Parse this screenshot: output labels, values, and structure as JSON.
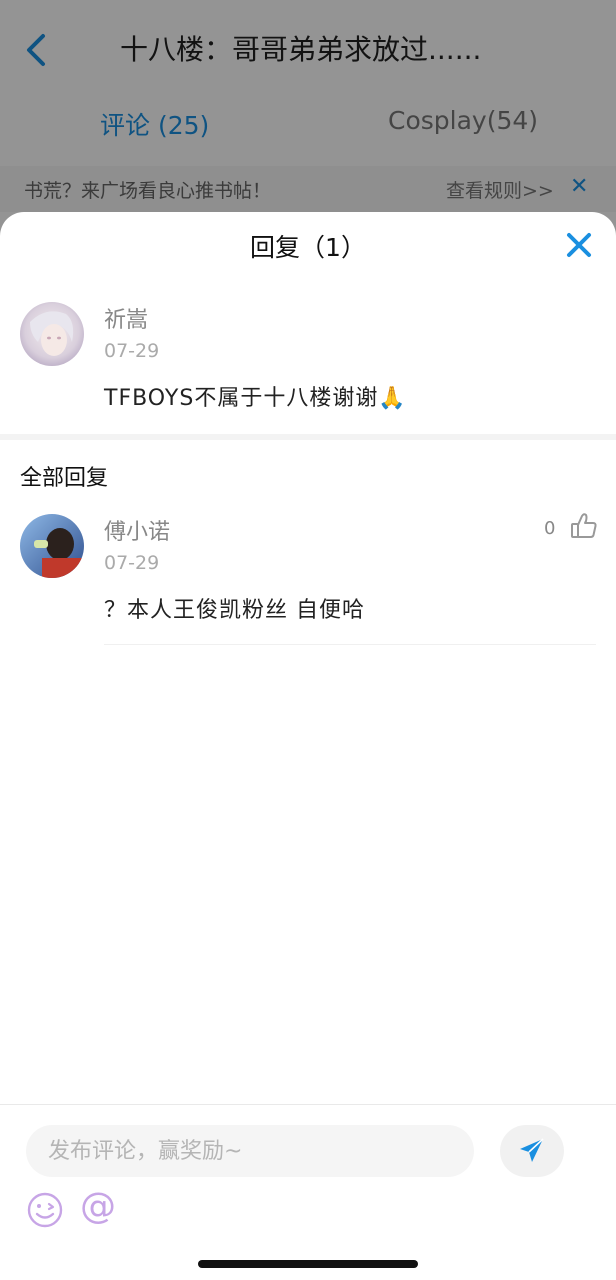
{
  "background": {
    "title": "十八楼：哥哥弟弟求放过......",
    "tabs": [
      {
        "label": "评论 (25)",
        "active": true
      },
      {
        "label": "Cosplay(54)",
        "active": false
      }
    ],
    "banner": {
      "text": "书荒？来广场看良心推书帖！",
      "rules_link": "查看规则>>",
      "close_symbol": "✕"
    }
  },
  "sheet": {
    "title": "回复（1）",
    "post": {
      "username": "祈嵩",
      "date": "07-29",
      "content": "TFBOYS不属于十八楼谢谢🙏"
    },
    "section_title": "全部回复",
    "replies": [
      {
        "username": "傅小诺",
        "date": "07-29",
        "content": "？本人王俊凯粉丝 自便哈",
        "likes": "0"
      }
    ]
  },
  "input": {
    "placeholder": "发布评论，赢奖励~",
    "value": "",
    "at_symbol": "@"
  },
  "colors": {
    "accent": "#1a8fe0",
    "overlay": "rgba(0,0,0,0.42)",
    "emoji_purple": "#c7a5e6"
  },
  "icons": [
    "back-arrow-icon",
    "close-icon",
    "thumbs-up-icon",
    "send-icon",
    "emoji-icon",
    "at-icon"
  ]
}
